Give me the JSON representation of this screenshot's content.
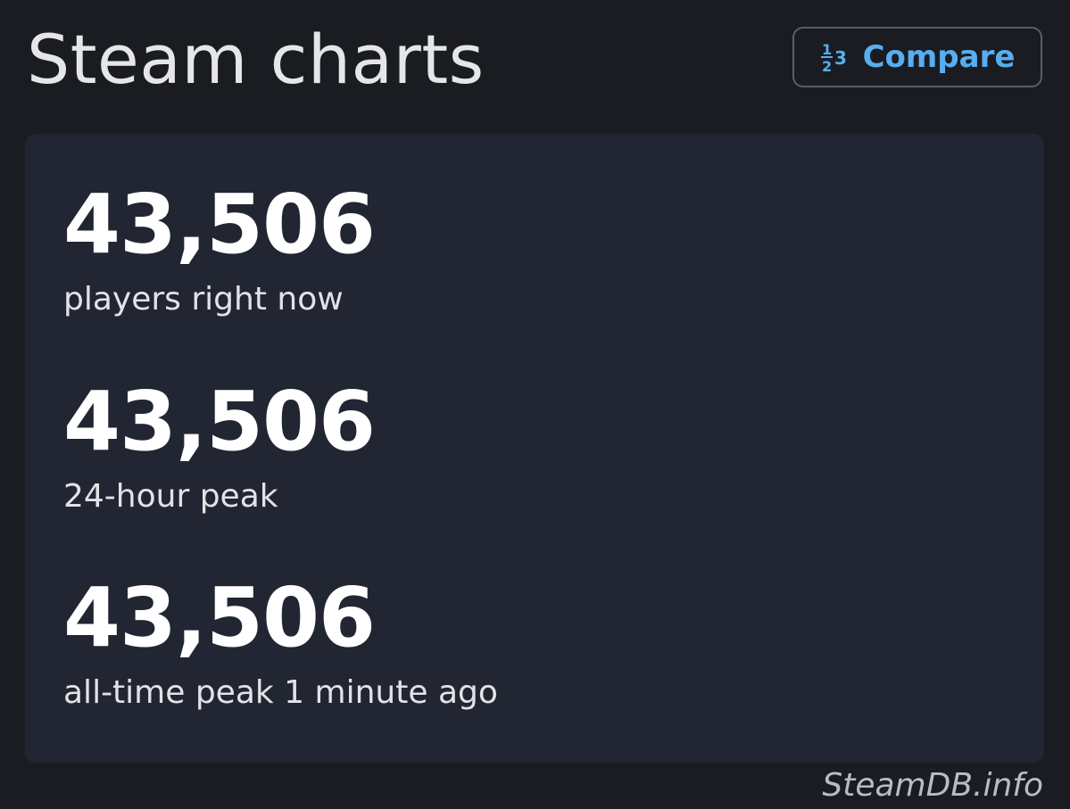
{
  "header": {
    "title": "Steam charts",
    "compare_label": "Compare",
    "compare_icon": "fraction-123-icon",
    "accent_color": "#57aef0"
  },
  "stats": [
    {
      "value": "43,506",
      "label": "players right now"
    },
    {
      "value": "43,506",
      "label": "24-hour peak"
    },
    {
      "value": "43,506",
      "label": "all-time peak 1 minute ago"
    }
  ],
  "footer": {
    "watermark": "SteamDB.info"
  }
}
